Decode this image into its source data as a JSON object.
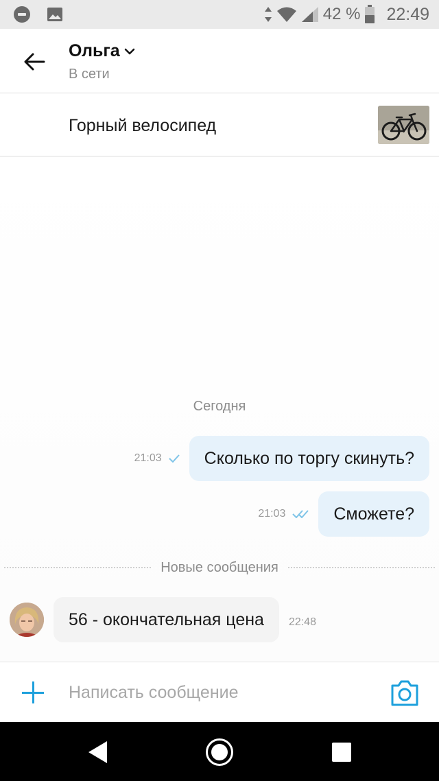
{
  "status_bar": {
    "battery": "42 %",
    "time": "22:49",
    "icons": [
      "do-not-disturb-icon",
      "image-icon",
      "data-arrows-icon",
      "wifi-icon",
      "signal-icon",
      "battery-icon"
    ]
  },
  "header": {
    "contact_name": "Ольга",
    "contact_status": "В сети"
  },
  "listing": {
    "title": "Горный велосипед"
  },
  "chat": {
    "date_separator": "Сегодня",
    "outgoing": [
      {
        "text": "Сколько по торгу скинуть?",
        "time": "21:03",
        "status": "sent"
      },
      {
        "text": "Сможете?",
        "time": "21:03",
        "status": "read"
      }
    ],
    "new_messages_label": "Новые сообщения",
    "incoming": [
      {
        "text": "56 - окончательная цена",
        "time": "22:48"
      }
    ]
  },
  "input": {
    "placeholder": "Написать сообщение"
  },
  "colors": {
    "accent": "#1ea0dc",
    "outgoing_bubble": "#e6f2fb",
    "incoming_bubble": "#f3f3f3",
    "read_tick": "#7fc4e8"
  }
}
